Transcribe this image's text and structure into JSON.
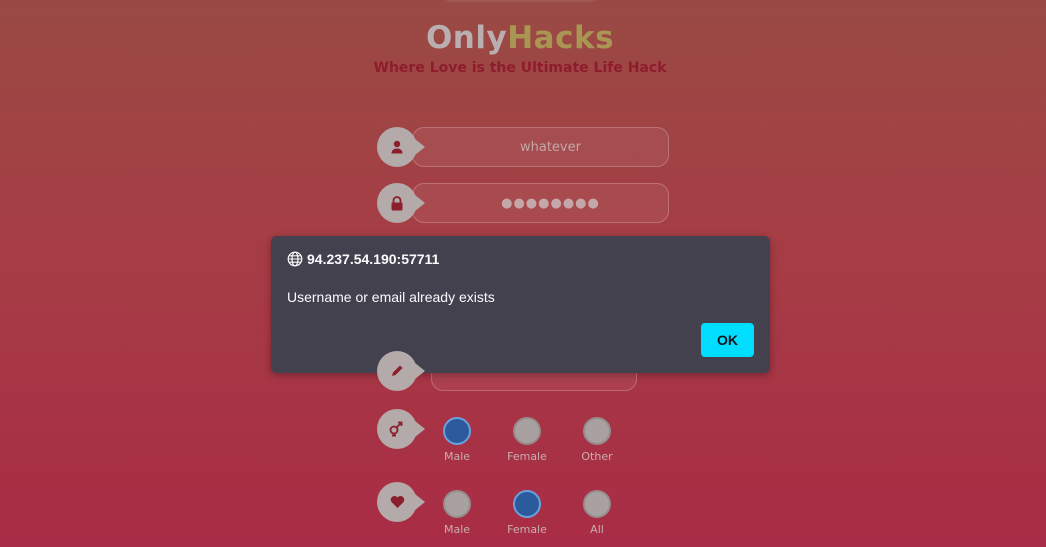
{
  "logo": {
    "part1": "Only",
    "part2": "Hacks"
  },
  "tagline": "Where Love is the Ultimate Life Hack",
  "form": {
    "username_value": "whatever",
    "password_value": "●●●●●●●●"
  },
  "gender": {
    "options": [
      "Male",
      "Female",
      "Other"
    ],
    "selected": "Male"
  },
  "interest": {
    "options": [
      "Male",
      "Female",
      "All"
    ],
    "selected": "Female"
  },
  "dialog": {
    "origin": "94.237.54.190:57711",
    "message": "Username or email already exists",
    "ok_label": "OK"
  },
  "colors": {
    "accent": "#00ddff",
    "dialog_bg": "#42414d",
    "selected_radio": "#2c5b9b"
  },
  "icons": [
    "user-icon",
    "lock-icon",
    "pencil-icon",
    "gender-icon",
    "heart-icon",
    "globe-icon"
  ]
}
